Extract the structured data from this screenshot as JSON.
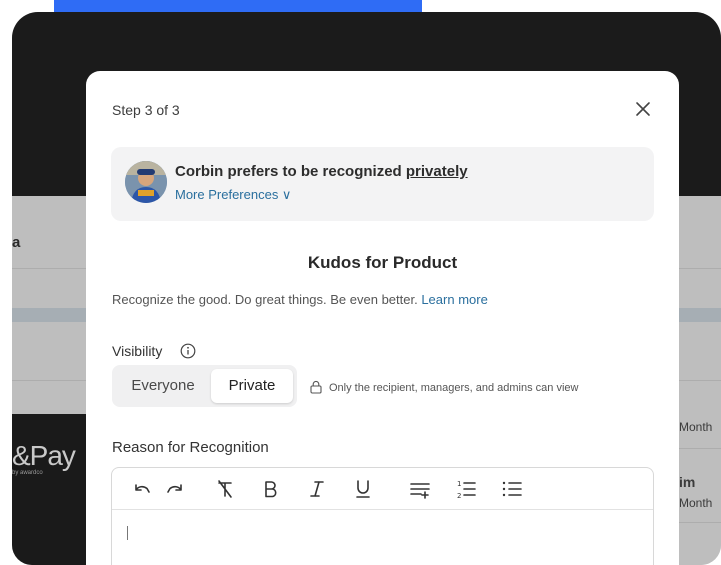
{
  "background": {
    "left_letter": "a",
    "pay_logo": "&Pay",
    "pay_sub": "by awardco",
    "right_texts": [
      "Month",
      "im",
      "Month"
    ]
  },
  "modal": {
    "step": "Step 3 of 3",
    "close_icon": "close-icon",
    "preference": {
      "text_prefix": "Corbin prefers to be recognized ",
      "text_emphasis": "privately",
      "more_link": "More Preferences ∨"
    },
    "title": "Kudos for Product",
    "subtitle": "Recognize the good. Do great things. Be even better.",
    "learn_more": "Learn more",
    "visibility": {
      "label": "Visibility",
      "options": [
        "Everyone",
        "Private"
      ],
      "selected": "Private",
      "note": "Only the recipient, managers, and admins can view"
    },
    "reason_label": "Reason for Recognition",
    "toolbar": [
      "undo-icon",
      "redo-icon",
      "clear-format-icon",
      "bold-icon",
      "italic-icon",
      "underline-icon",
      "indent-icon",
      "ordered-list-icon",
      "bullet-list-icon"
    ]
  },
  "colors": {
    "accent_link": "#2a6f9e",
    "top_bar": "#2f6cf5"
  }
}
